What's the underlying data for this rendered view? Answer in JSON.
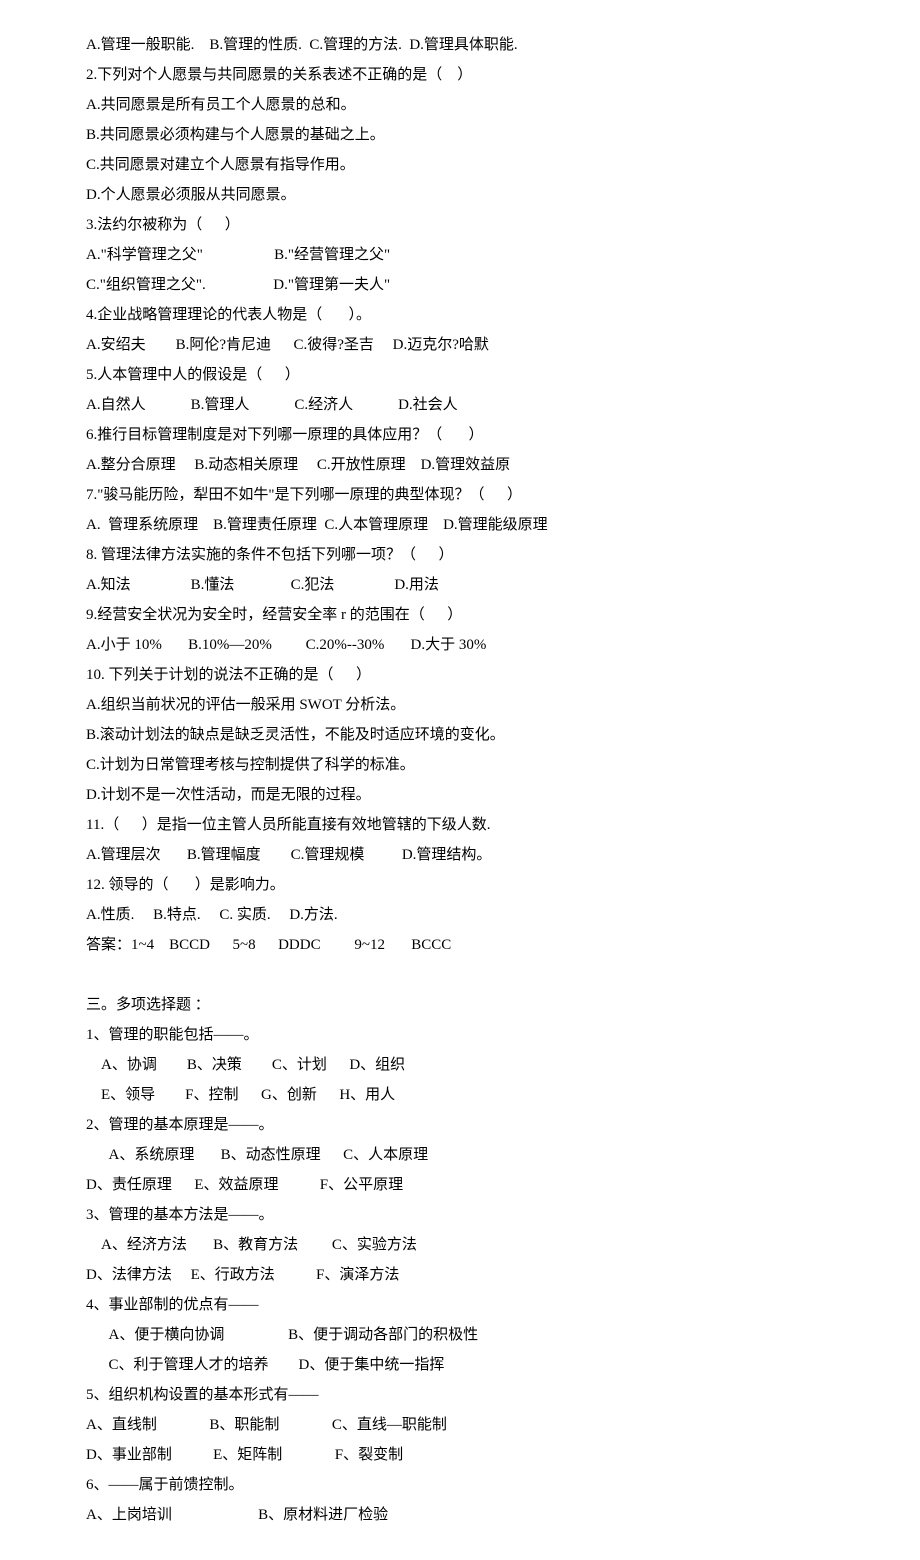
{
  "lines": [
    "A.管理一般职能.    B.管理的性质.  C.管理的方法.  D.管理具体职能.",
    "2.下列对个人愿景与共同愿景的关系表述不正确的是（    ）",
    "A.共同愿景是所有员工个人愿景的总和。",
    "B.共同愿景必须构建与个人愿景的基础之上。",
    "C.共同愿景对建立个人愿景有指导作用。",
    "D.个人愿景必须服从共同愿景。",
    "3.法约尔被称为（      ）",
    "A.\"科学管理之父\"                   B.\"经营管理之父\"",
    "C.\"组织管理之父\".                  D.\"管理第一夫人\"",
    "4.企业战略管理理论的代表人物是（       ）。",
    "A.安绍夫        B.阿伦?肯尼迪      C.彼得?圣吉     D.迈克尔?哈默",
    "5.人本管理中人的假设是（      ）",
    "A.自然人            B.管理人            C.经济人            D.社会人",
    "6.推行目标管理制度是对下列哪一原理的具体应用？（       ）",
    "A.整分合原理     B.动态相关原理     C.开放性原理    D.管理效益原",
    "7.\"骏马能历险，犁田不如牛\"是下列哪一原理的典型体现？（      ）",
    "A.  管理系统原理    B.管理责任原理  C.人本管理原理    D.管理能级原理",
    "8. 管理法律方法实施的条件不包括下列哪一项？（      ）",
    "A.知法                B.懂法               C.犯法                D.用法",
    "9.经营安全状况为安全时，经营安全率 r 的范围在（      ）",
    "A.小于 10%       B.10%—20%         C.20%--30%       D.大于 30%",
    "10. 下列关于计划的说法不正确的是（      ）",
    "A.组织当前状况的评估一般采用 SWOT 分析法。",
    "B.滚动计划法的缺点是缺乏灵活性，不能及时适应环境的变化。",
    "C.计划为日常管理考核与控制提供了科学的标准。",
    "D.计划不是一次性活动，而是无限的过程。",
    "11.（      ）是指一位主管人员所能直接有效地管辖的下级人数.",
    "A.管理层次       B.管理幅度        C.管理规模          D.管理结构。",
    "12. 领导的（       ）是影响力。",
    "A.性质.     B.特点.     C. 实质.     D.方法.",
    "答案：1~4    BCCD      5~8      DDDC         9~12       BCCC",
    "",
    "三。多项选择题 ：",
    "1、管理的职能包括——。",
    "    A、协调        B、决策        C、计划      D、组织",
    "    E、领导        F、控制      G、创新      H、用人",
    "2、管理的基本原理是——。",
    "      A、系统原理       B、动态性原理      C、人本原理",
    "D、责任原理      E、效益原理           F、公平原理",
    "3、管理的基本方法是——。",
    "    A、经济方法       B、教育方法         C、实验方法",
    "D、法律方法     E、行政方法           F、演泽方法",
    "4、事业部制的优点有——",
    "      A、便于横向协调                 B、便于调动各部门的积极性",
    "      C、利于管理人才的培养        D、便于集中统一指挥",
    "5、组织机构设置的基本形式有——",
    "A、直线制              B、职能制              C、直线—职能制",
    "D、事业部制           E、矩阵制              F、裂变制",
    "6、——属于前馈控制。",
    "A、上岗培训                       B、原材料进厂检验"
  ]
}
